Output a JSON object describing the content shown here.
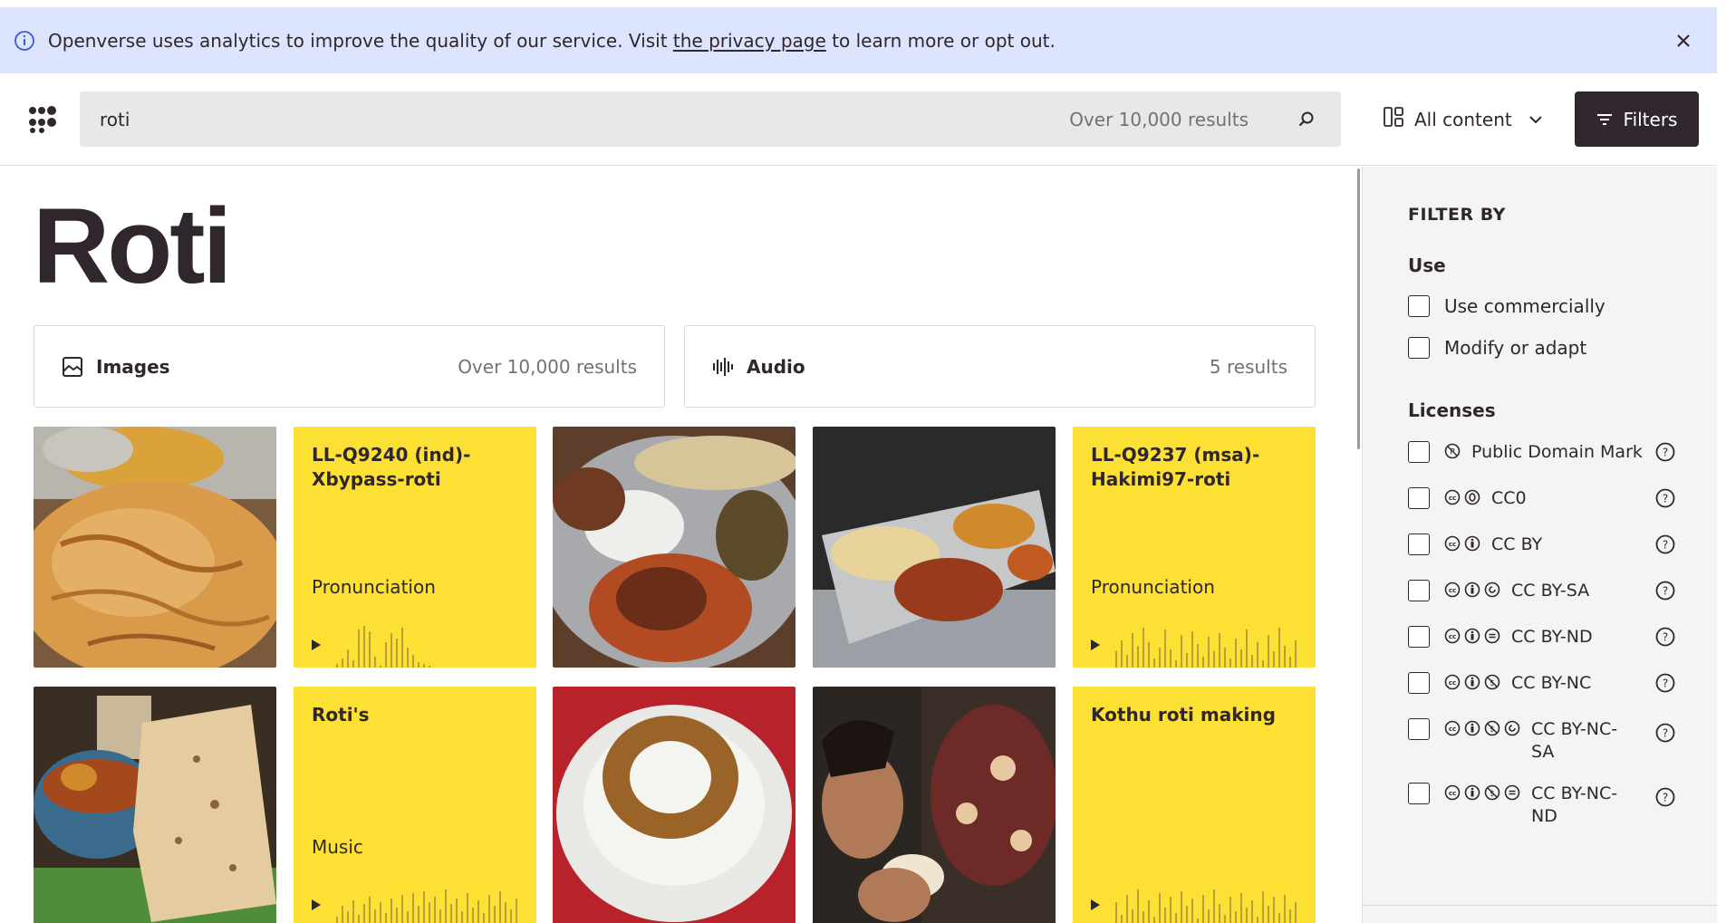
{
  "banner": {
    "text_before": "Openverse uses analytics to improve the quality of our service. Visit ",
    "link": "the privacy page",
    "text_after": " to learn more or opt out.",
    "close_icon": "close-icon",
    "info_icon": "info-icon"
  },
  "header": {
    "search_value": "roti",
    "result_count": "Over 10,000 results",
    "content_type": "All content",
    "filters_label": "Filters"
  },
  "page": {
    "title": "Roti"
  },
  "media_types": [
    {
      "label": "Images",
      "results": "Over 10,000 results",
      "icon": "image-icon"
    },
    {
      "label": "Audio",
      "results": "5 results",
      "icon": "audio-icon"
    }
  ],
  "audio_tiles": [
    {
      "title": "LL-Q9240 (ind)-Xbypass-roti",
      "category": "Pronunciation"
    },
    {
      "title": "LL-Q9237 (msa)-Hakimi97-roti",
      "category": "Pronunciation"
    },
    {
      "title": "Roti's",
      "category": "Music"
    },
    {
      "title": "Kothu roti making",
      "category": ""
    }
  ],
  "image_tiles": [
    {
      "icon": "roti-canai-plate-image"
    },
    {
      "icon": "curry-rice-platter-image"
    },
    {
      "icon": "roti-tray-image"
    },
    {
      "icon": "curry-bowl-roti-image"
    },
    {
      "icon": "ring-bread-plate-image"
    },
    {
      "icon": "child-eating-roti-image"
    }
  ],
  "sidebar": {
    "filter_by": "FILTER BY",
    "use_title": "Use",
    "use_options": [
      "Use commercially",
      "Modify or adapt"
    ],
    "licenses_title": "Licenses",
    "licenses": [
      {
        "label": "Public Domain Mark",
        "icons": [
          "pdm"
        ]
      },
      {
        "label": "CC0",
        "icons": [
          "cc",
          "zero"
        ]
      },
      {
        "label": "CC BY",
        "icons": [
          "cc",
          "by"
        ]
      },
      {
        "label": "CC BY-SA",
        "icons": [
          "cc",
          "by",
          "sa"
        ]
      },
      {
        "label": "CC BY-ND",
        "icons": [
          "cc",
          "by",
          "nd"
        ]
      },
      {
        "label": "CC BY-NC",
        "icons": [
          "cc",
          "by",
          "nc"
        ]
      },
      {
        "label": "CC BY-NC-SA",
        "icons": [
          "cc",
          "by",
          "nc",
          "sa"
        ]
      },
      {
        "label": "CC BY-NC-ND",
        "icons": [
          "cc",
          "by",
          "nc",
          "nd"
        ]
      }
    ]
  },
  "colors": {
    "banner_bg": "#dde4fd",
    "audio_tile_bg": "#fde034",
    "dark": "#30272e",
    "sidebar_bg": "#f4f4f4"
  }
}
